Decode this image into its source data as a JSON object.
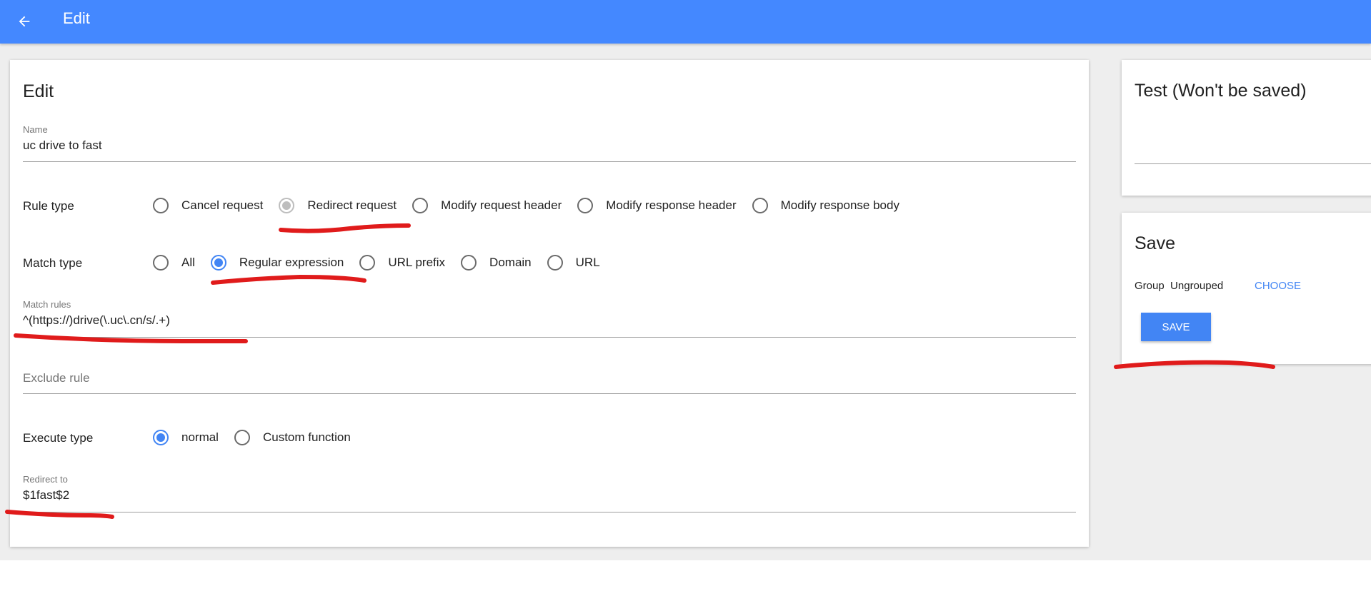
{
  "appbar": {
    "title": "Edit",
    "back_icon": "arrow-left-icon",
    "color": "#4488ff"
  },
  "edit": {
    "title": "Edit",
    "name": {
      "label": "Name",
      "value": "uc drive to fast"
    },
    "rule_type": {
      "label": "Rule type",
      "options": [
        {
          "label": "Cancel request",
          "state": "unchecked"
        },
        {
          "label": "Redirect request",
          "state": "checked-disabled"
        },
        {
          "label": "Modify request header",
          "state": "unchecked"
        },
        {
          "label": "Modify response header",
          "state": "unchecked"
        },
        {
          "label": "Modify response body",
          "state": "unchecked"
        }
      ]
    },
    "match_type": {
      "label": "Match type",
      "options": [
        {
          "label": "All",
          "state": "unchecked"
        },
        {
          "label": "Regular expression",
          "state": "checked"
        },
        {
          "label": "URL prefix",
          "state": "unchecked"
        },
        {
          "label": "Domain",
          "state": "unchecked"
        },
        {
          "label": "URL",
          "state": "unchecked"
        }
      ]
    },
    "match_rules": {
      "label": "Match rules",
      "value": "^(https://)drive(\\.uc\\.cn/s/.+)"
    },
    "exclude_rule": {
      "placeholder": "Exclude rule"
    },
    "execute_type": {
      "label": "Execute type",
      "options": [
        {
          "label": "normal",
          "state": "checked"
        },
        {
          "label": "Custom function",
          "state": "unchecked"
        }
      ]
    },
    "redirect_to": {
      "label": "Redirect to",
      "value": "$1fast$2"
    }
  },
  "test": {
    "title": "Test (Won't be saved)"
  },
  "save": {
    "title": "Save",
    "group_label": "Group",
    "group_value": "Ungrouped",
    "choose_label": "CHOOSE",
    "save_label": "SAVE"
  },
  "colors": {
    "accent": "#4285f4",
    "annotation": "#e01b1b"
  }
}
